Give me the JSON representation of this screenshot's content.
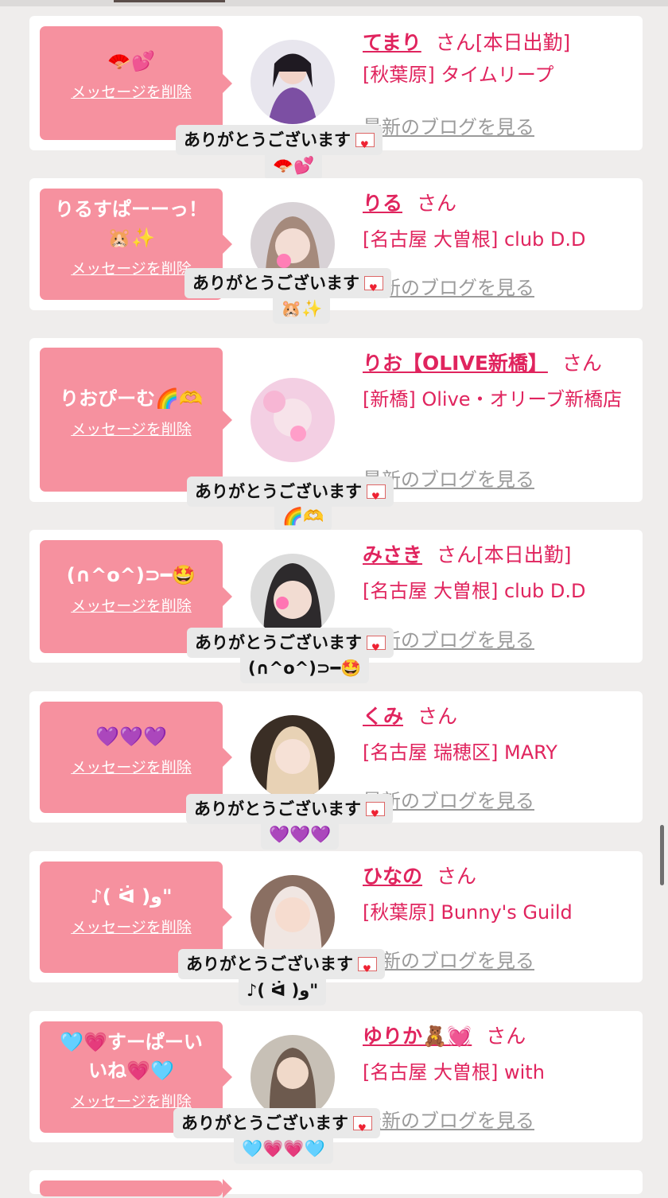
{
  "texts": {
    "delete_label": "メッセージを削除",
    "thanks_text": "ありがとうございます",
    "san": "さん",
    "blog_label": "最新のブログを見る"
  },
  "cards": [
    {
      "message": "🪭💕",
      "name": "てまり",
      "status": "[本日出勤]",
      "shop": "[秋葉原] タイムリープ",
      "reply": "🪭💕"
    },
    {
      "message": "りるすぱーーっ！\n🐹✨",
      "name": "りる",
      "status": "",
      "shop": "[名古屋 大曽根] club D.D",
      "reply": "🐹✨"
    },
    {
      "message": "りおぴーむ🌈🫶",
      "name": "りお【OLIVE新橋】",
      "status": "",
      "shop": "[新橋] Olive・オリーブ新橋店",
      "reply": "🌈🫶"
    },
    {
      "message": "(∩^o^)⊃━🤩",
      "name": "みさき",
      "status": "[本日出勤]",
      "shop": "[名古屋 大曽根] club D.D",
      "reply": "(∩^o^)⊃━🤩"
    },
    {
      "message": "💜💜💜",
      "name": "くみ",
      "status": "",
      "shop": "[名古屋 瑞穂区] MARY",
      "reply": "💜💜💜"
    },
    {
      "message": "♪( ᐛ )و\"",
      "name": "ひなの",
      "status": "",
      "shop": "[秋葉原] Bunny's Guild",
      "reply": "♪( ᐛ )و\""
    },
    {
      "message": "🩵💗すーぱーい\nいね💗🩵",
      "name": "ゆりか🧸💓",
      "status": "",
      "shop": "[名古屋 大曽根] with",
      "reply": "🩵💗💗🩵"
    }
  ],
  "colors": {
    "accent": "#e0245e",
    "bubble": "#f6919f",
    "background": "#efedec"
  }
}
